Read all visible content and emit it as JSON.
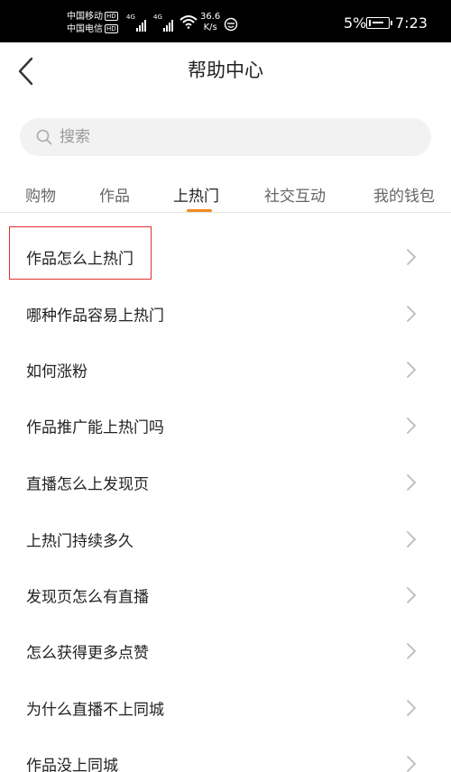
{
  "status_bar": {
    "carrier1": "中国移动",
    "carrier2": "中国电信",
    "hd": "HD",
    "net1": "4G",
    "net2": "4G",
    "speed_value": "36.6",
    "speed_unit": "K/s",
    "battery_percent": "5%",
    "time": "7:23"
  },
  "header": {
    "title": "帮助中心",
    "back_icon": "chevron-left-icon"
  },
  "search": {
    "placeholder": "搜索",
    "icon": "search-icon"
  },
  "tabs": [
    {
      "label": "购物",
      "active": false
    },
    {
      "label": "作品",
      "active": false
    },
    {
      "label": "上热门",
      "active": true
    },
    {
      "label": "社交互动",
      "active": false
    },
    {
      "label": "我的钱包",
      "active": false
    }
  ],
  "list": {
    "items": [
      {
        "label": "作品怎么上热门",
        "highlighted": true
      },
      {
        "label": "哪种作品容易上热门"
      },
      {
        "label": "如何涨粉"
      },
      {
        "label": "作品推广能上热门吗"
      },
      {
        "label": "直播怎么上发现页"
      },
      {
        "label": "上热门持续多久"
      },
      {
        "label": "发现页怎么有直播"
      },
      {
        "label": "怎么获得更多点赞"
      },
      {
        "label": "为什么直播不上同城"
      },
      {
        "label": "作品没上同城"
      }
    ]
  },
  "colors": {
    "accent": "#f08a1e",
    "highlight_border": "#e0302a",
    "search_bg": "#f2f2f2"
  }
}
